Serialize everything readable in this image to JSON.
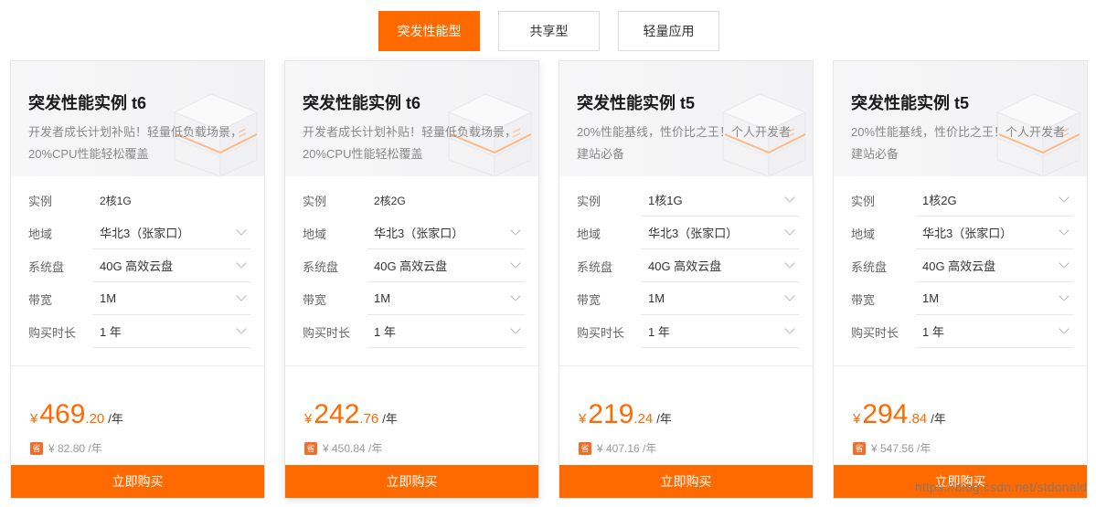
{
  "tabs": [
    {
      "label": "突发性能型",
      "active": true
    },
    {
      "label": "共享型",
      "active": false
    },
    {
      "label": "轻量应用",
      "active": false
    }
  ],
  "spec_labels": {
    "instance": "实例",
    "region": "地域",
    "disk": "系统盘",
    "bandwidth": "带宽",
    "duration": "购买时长"
  },
  "cards": [
    {
      "title": "突发性能实例 t6",
      "desc": "开发者成长计划补贴！轻量低负载场景，20%CPU性能轻松覆盖",
      "instance": "2核1G",
      "region": "华北3（张家口）",
      "disk": "40G 高效云盘",
      "bandwidth": "1M",
      "duration": "1 年",
      "currency": "¥",
      "price_int": "469",
      "price_dec": ".20",
      "price_unit": "/年",
      "save_badge": "省",
      "save_text": "¥ 82.80 /年",
      "buy_label": "立即购买"
    },
    {
      "title": "突发性能实例 t6",
      "desc": "开发者成长计划补贴！轻量低负载场景，20%CPU性能轻松覆盖",
      "instance": "2核2G",
      "region": "华北3（张家口）",
      "disk": "40G 高效云盘",
      "bandwidth": "1M",
      "duration": "1 年",
      "currency": "¥",
      "price_int": "242",
      "price_dec": ".76",
      "price_unit": "/年",
      "save_badge": "省",
      "save_text": "¥ 450.84 /年",
      "buy_label": "立即购买"
    },
    {
      "title": "突发性能实例 t5",
      "desc": "20%性能基线，性价比之王！个人开发者建站必备",
      "instance": "1核1G",
      "region": "华北3（张家口）",
      "disk": "40G 高效云盘",
      "bandwidth": "1M",
      "duration": "1 年",
      "currency": "¥",
      "price_int": "219",
      "price_dec": ".24",
      "price_unit": "/年",
      "save_badge": "省",
      "save_text": "¥ 407.16 /年",
      "buy_label": "立即购买"
    },
    {
      "title": "突发性能实例 t5",
      "desc": "20%性能基线，性价比之王！个人开发者建站必备",
      "instance": "1核2G",
      "region": "华北3（张家口）",
      "disk": "40G 高效云盘",
      "bandwidth": "1M",
      "duration": "1 年",
      "currency": "¥",
      "price_int": "294",
      "price_dec": ".84",
      "price_unit": "/年",
      "save_badge": "省",
      "save_text": "¥ 547.56 /年",
      "buy_label": "立即购买"
    }
  ],
  "watermark": "https://blog.csdn.net/stdonald",
  "colors": {
    "accent": "#ff6a00",
    "save_badge": "#f56c2a"
  },
  "icons": {
    "dropdown": "chevron-down-icon",
    "art": "server-illustration"
  }
}
